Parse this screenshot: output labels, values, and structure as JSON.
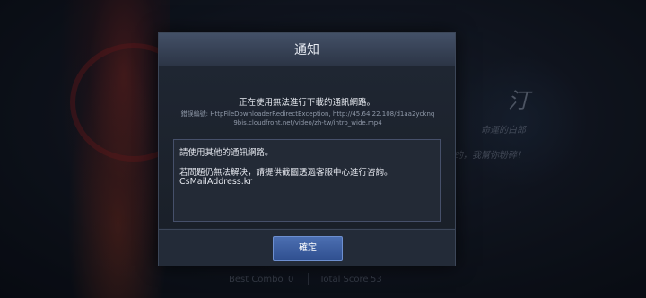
{
  "background": {
    "hero_glyph": "汀",
    "hero_subtitle": "命運的白郎",
    "hero_quote": "的，我幫你粉碎！",
    "stats": {
      "best_combo_label": "Best Combo",
      "best_combo_value": "0",
      "total_score_label": "Total Score",
      "total_score_value": "53"
    }
  },
  "dialog": {
    "title": "通知",
    "headline": "正在使用無法進行下載的通訊網路。",
    "error_detail": "錯誤編號: HttpFileDownloaderRedirectException, http://45.64.22.108/d1aa2ycknq9bis.cloudfront.net/video/zh-tw/intro_wide.mp4",
    "message": {
      "line1": "請使用其他的通訊網路。",
      "line2": "若問題仍無法解決，請提供截圖透過客服中心進行咨詢。",
      "email": "CsMailAddress.kr"
    },
    "confirm_label": "確定"
  },
  "colors": {
    "dialog_bg": "#1c232f",
    "header_bg": "#435067",
    "button_blue": "#3d5fa0"
  }
}
